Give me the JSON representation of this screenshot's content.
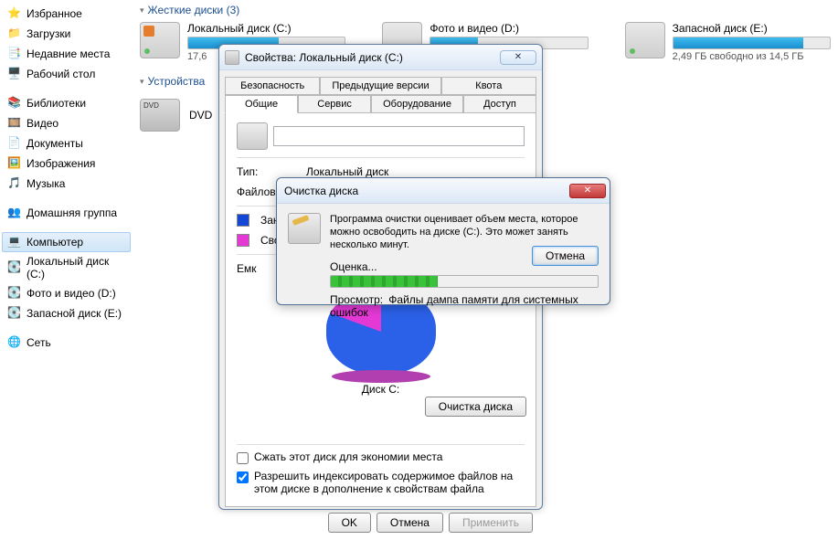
{
  "sidebar": {
    "favorites": {
      "label": "Избранное"
    },
    "downloads": {
      "label": "Загрузки"
    },
    "recent": {
      "label": "Недавние места"
    },
    "desktop": {
      "label": "Рабочий стол"
    },
    "libraries": {
      "label": "Библиотеки"
    },
    "video": {
      "label": "Видео"
    },
    "documents": {
      "label": "Документы"
    },
    "pictures": {
      "label": "Изображения"
    },
    "music": {
      "label": "Музыка"
    },
    "homegroup": {
      "label": "Домашняя группа"
    },
    "computer": {
      "label": "Компьютер"
    },
    "drive_c": {
      "label": "Локальный диск (C:)"
    },
    "drive_d": {
      "label": "Фото и видео (D:)"
    },
    "drive_e": {
      "label": "Запасной диск (E:)"
    },
    "network": {
      "label": "Сеть"
    }
  },
  "main": {
    "hdd_header": "Жесткие диски (3)",
    "devices_header": "Устройства",
    "drives": {
      "c": {
        "name": "Локальный диск (C:)",
        "free": "17,6"
      },
      "d": {
        "name": "Фото и видео (D:)",
        "free": ""
      },
      "e": {
        "name": "Запасной диск (E:)",
        "free": "2,49 ГБ свободно из 14,5 ГБ"
      }
    },
    "dvd": {
      "label": "DVD"
    }
  },
  "props": {
    "title": "Свойства: Локальный диск (C:)",
    "tabs": {
      "security": "Безопасность",
      "prev_versions": "Предыдущие версии",
      "quota": "Квота",
      "general": "Общие",
      "service": "Сервис",
      "hardware": "Оборудование",
      "access": "Доступ"
    },
    "type_label": "Тип:",
    "type_value": "Локальный диск",
    "fs_label": "Файлов",
    "used_label": "Зан",
    "free_label": "Сво",
    "capacity_label": "Емк",
    "disk_label": "Диск C:",
    "cleanup_btn": "Очистка диска",
    "compress_chk": "Сжать этот диск для экономии места",
    "index_chk": "Разрешить индексировать содержимое файлов на этом диске в дополнение к свойствам файла",
    "ok": "OK",
    "cancel": "Отмена",
    "apply": "Применить"
  },
  "cleanup": {
    "title": "Очистка диска",
    "message": "Программа очистки оценивает объем места, которое можно освободить на диске  (C:). Это может занять несколько минут.",
    "estimate_label": "Оценка...",
    "view_label": "Просмотр:",
    "view_value": "Файлы дампа памяти для системных ошибок",
    "cancel": "Отмена"
  }
}
